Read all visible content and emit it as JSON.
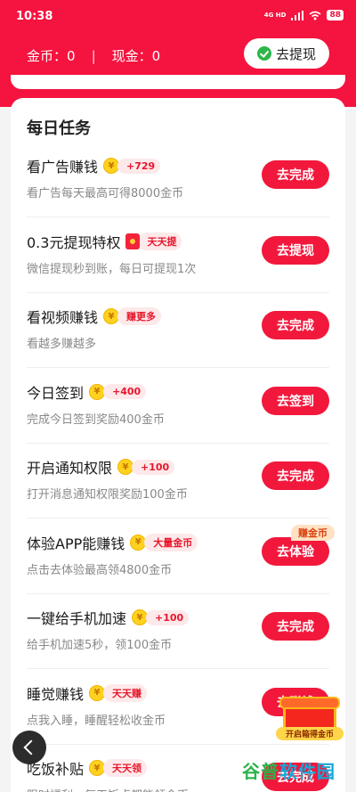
{
  "status_bar": {
    "time": "10:38",
    "network": "4G HD",
    "battery": "88"
  },
  "wallet": {
    "coins_label": "金币：",
    "coins": "0",
    "cash_label": "现金：",
    "cash": "0",
    "withdraw_button": "去提现"
  },
  "tasks_title": "每日任务",
  "tasks": [
    {
      "name": "看广告赚钱",
      "badge_icon": "coin-icon",
      "badge": "+729",
      "desc": "看广告每天最高可得8000金币",
      "button": "去完成"
    },
    {
      "name": "0.3元提现特权",
      "badge_icon": "red-envelope-icon",
      "badge": "天天提",
      "desc": "微信提现秒到账，每日可提现1次",
      "button": "去提现"
    },
    {
      "name": "看视频赚钱",
      "badge_icon": "coin-icon",
      "badge": "赚更多",
      "desc": "看越多赚越多",
      "button": "去完成"
    },
    {
      "name": "今日签到",
      "badge_icon": "coin-icon",
      "badge": "+400",
      "desc": "完成今日签到奖励400金币",
      "button": "去签到"
    },
    {
      "name": "开启通知权限",
      "badge_icon": "coin-icon",
      "badge": "+100",
      "desc": "打开消息通知权限奖励100金币",
      "button": "去完成"
    },
    {
      "name": "体验APP能赚钱",
      "badge_icon": "coin-icon",
      "badge": "大量金币",
      "desc": "点击去体验最高领4800金币",
      "button": "去体验",
      "ribbon": "赚金币"
    },
    {
      "name": "一键给手机加速",
      "badge_icon": "coin-icon",
      "badge": "+100",
      "desc": "给手机加速5秒，领100金币",
      "button": "去完成"
    },
    {
      "name": "睡觉赚钱",
      "badge_icon": "coin-icon",
      "badge": "天天赚",
      "desc": "点我入睡，睡醒轻松收金币",
      "button": "去赚钱"
    },
    {
      "name": "吃饭补贴",
      "badge_icon": "coin-icon",
      "badge": "天天领",
      "desc": "限时福利，每天饭点都能领金币",
      "button": "去完成"
    }
  ],
  "coin_glyph": "¥",
  "floating_gift": {
    "label": "开启箱得金币"
  },
  "watermark": {
    "text_a": "谷普",
    "text_b": "软件园"
  },
  "colors": {
    "brand_red": "#f5133f",
    "button_red": "#f2183c"
  }
}
